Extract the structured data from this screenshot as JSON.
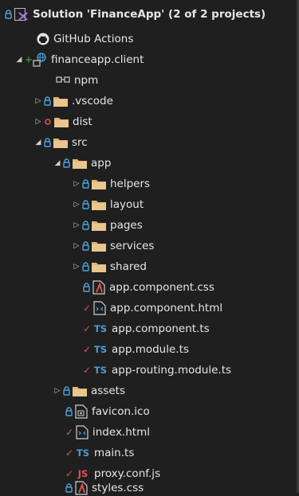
{
  "solution": {
    "label": "Solution 'FinanceApp' (2 of 2 projects)"
  },
  "items": {
    "github": "GitHub Actions",
    "project": "financeapp.client",
    "npm": "npm",
    "vscode": ".vscode",
    "dist": "dist",
    "src": "src",
    "app": "app",
    "helpers": "helpers",
    "layout": "layout",
    "pages": "pages",
    "services": "services",
    "shared": "shared",
    "app_css": "app.component.css",
    "app_html": "app.component.html",
    "app_ts": "app.component.ts",
    "app_module": "app.module.ts",
    "app_routing": "app-routing.module.ts",
    "assets": "assets",
    "favicon": "favicon.ico",
    "index": "index.html",
    "main": "main.ts",
    "proxy": "proxy.conf.js",
    "styles": "styles.css"
  },
  "badges": {
    "ts": "TS",
    "js": "JS"
  },
  "colors": {
    "background": "#1f1f1f",
    "folder": "#dcb67a",
    "lock": "#4aa3df",
    "modified": "#d9534f",
    "added": "#4caf50"
  }
}
